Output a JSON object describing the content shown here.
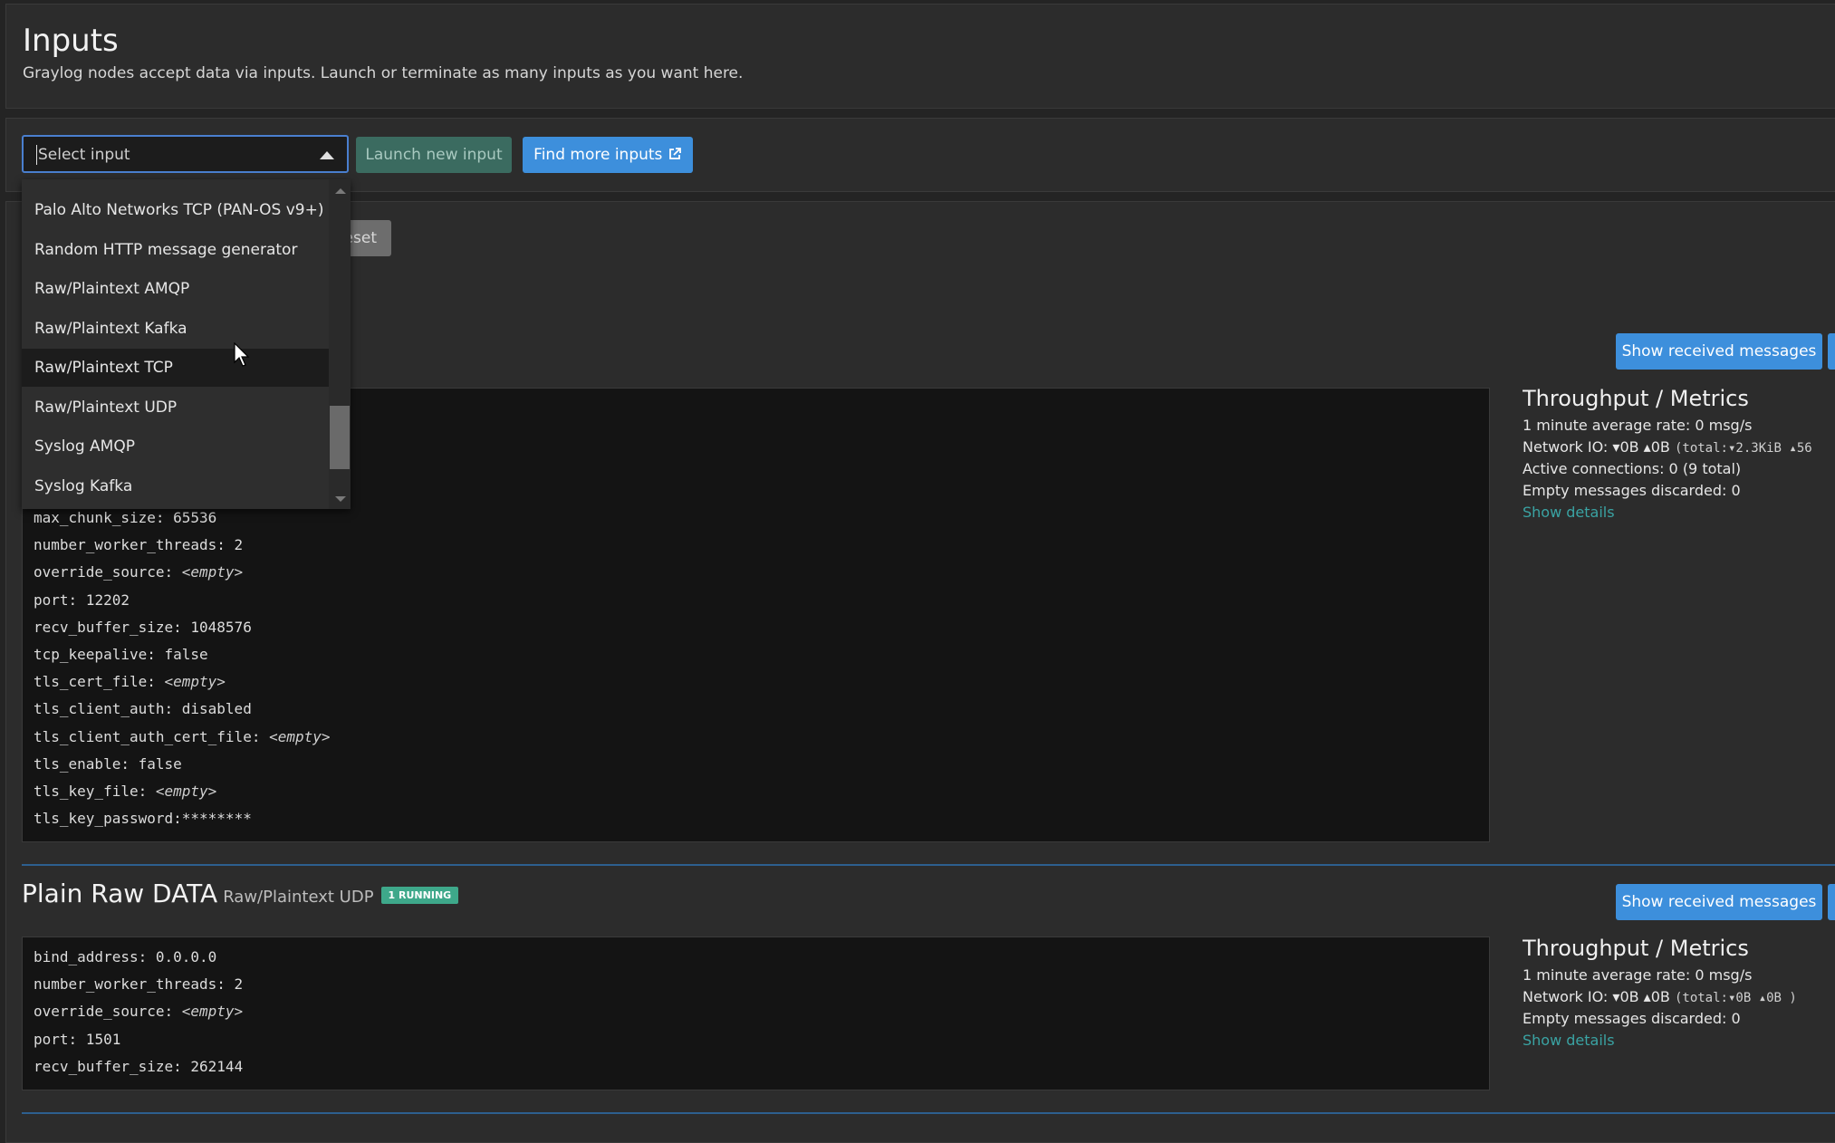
{
  "header": {
    "title": "Inputs",
    "description": "Graylog nodes accept data via inputs. Launch or terminate as many inputs as you want here."
  },
  "controls": {
    "select_placeholder": "Select input",
    "launch_label": "Launch new input",
    "find_label": "Find more inputs",
    "reset_label": "eset"
  },
  "dropdown": {
    "items": [
      "Palo Alto Networks TCP (PAN-OS v9+)",
      "Random HTTP message generator",
      "Raw/Plaintext AMQP",
      "Raw/Plaintext Kafka",
      "Raw/Plaintext TCP",
      "Raw/Plaintext UDP",
      "Syslog AMQP",
      "Syslog Kafka"
    ],
    "active_item": "Raw/Plaintext TCP"
  },
  "input1": {
    "show_messages_label": "Show received messages",
    "config": [
      {
        "key": "max_chunk_size:",
        "value": "65536",
        "empty": false
      },
      {
        "key": "number_worker_threads:",
        "value": "2",
        "empty": false
      },
      {
        "key": "override_source:",
        "value": "<empty>",
        "empty": true
      },
      {
        "key": "port:",
        "value": "12202",
        "empty": false
      },
      {
        "key": "recv_buffer_size:",
        "value": "1048576",
        "empty": false
      },
      {
        "key": "tcp_keepalive:",
        "value": "false",
        "empty": false
      },
      {
        "key": "tls_cert_file:",
        "value": "<empty>",
        "empty": true
      },
      {
        "key": "tls_client_auth:",
        "value": "disabled",
        "empty": false
      },
      {
        "key": "tls_client_auth_cert_file:",
        "value": "<empty>",
        "empty": true
      },
      {
        "key": "tls_enable:",
        "value": "false",
        "empty": false
      },
      {
        "key": "tls_key_file:",
        "value": "<empty>",
        "empty": true
      },
      {
        "key": "tls_key_password:",
        "value": "********",
        "empty": false
      }
    ],
    "metrics": {
      "title": "Throughput / Metrics",
      "rate": "1 minute average rate: 0 msg/s",
      "network_label": "Network IO:",
      "network_value": "▾0B ▴0B",
      "network_total": "(total:",
      "network_total_value": "▾2.3KiB ▴56",
      "connections": "Active connections: 0 (9 total)",
      "discarded": "Empty messages discarded: 0",
      "details_label": "Show details"
    }
  },
  "input2": {
    "title": "Plain Raw DATA",
    "type": "Raw/Plaintext UDP",
    "badge": "1 RUNNING",
    "show_messages_label": "Show received messages",
    "config": [
      {
        "key": "bind_address:",
        "value": "0.0.0.0",
        "empty": false
      },
      {
        "key": "number_worker_threads:",
        "value": "2",
        "empty": false
      },
      {
        "key": "override_source:",
        "value": "<empty>",
        "empty": true
      },
      {
        "key": "port:",
        "value": "1501",
        "empty": false
      },
      {
        "key": "recv_buffer_size:",
        "value": "262144",
        "empty": false
      }
    ],
    "metrics": {
      "title": "Throughput / Metrics",
      "rate": "1 minute average rate: 0 msg/s",
      "network_label": "Network IO:",
      "network_value": "▾0B ▴0B",
      "network_total": "(total:",
      "network_total_value": "▾0B ▴0B )",
      "discarded": "Empty messages discarded: 0",
      "details_label": "Show details"
    }
  }
}
